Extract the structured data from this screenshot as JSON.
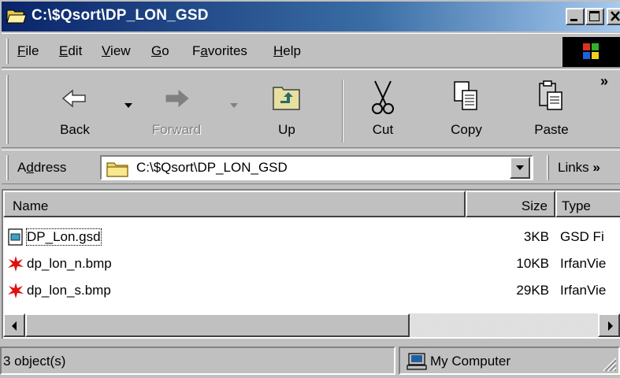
{
  "window": {
    "title": "C:\\$Qsort\\DP_LON_GSD"
  },
  "menu": {
    "items": [
      {
        "label": "File",
        "ul": "F",
        "rest": "ile"
      },
      {
        "label": "Edit",
        "ul": "E",
        "rest": "dit"
      },
      {
        "label": "View",
        "ul": "V",
        "rest": "iew"
      },
      {
        "label": "Go",
        "ul": "G",
        "rest": "o"
      },
      {
        "label": "Favorites",
        "pre": "F",
        "ul": "a",
        "rest": "vorites"
      },
      {
        "label": "Help",
        "ul": "H",
        "rest": "elp"
      }
    ]
  },
  "toolbar": {
    "back_label": "Back",
    "forward_label": "Forward",
    "up_label": "Up",
    "cut_label": "Cut",
    "copy_label": "Copy",
    "paste_label": "Paste",
    "chevron": "»"
  },
  "address": {
    "label_pre": "A",
    "label_ul": "d",
    "label_rest": "dress",
    "value": "C:\\$Qsort\\DP_LON_GSD",
    "links_label": "Links",
    "links_chevron": "»"
  },
  "list": {
    "columns": {
      "name": "Name",
      "size": "Size",
      "type": "Type"
    },
    "rows": [
      {
        "name": "DP_Lon.gsd",
        "size": "3KB",
        "type": "GSD Fi",
        "icon": "gsd-file-icon"
      },
      {
        "name": "dp_lon_n.bmp",
        "size": "10KB",
        "type": "IrfanVie",
        "icon": "irfanview-bmp-icon"
      },
      {
        "name": "dp_lon_s.bmp",
        "size": "29KB",
        "type": "IrfanVie",
        "icon": "irfanview-bmp-icon"
      }
    ]
  },
  "status": {
    "objects": "3 object(s)",
    "zone": "My Computer"
  },
  "colors": {
    "title_start": "#0a246a",
    "title_end": "#a6caf0",
    "face": "#c0c0c0"
  }
}
